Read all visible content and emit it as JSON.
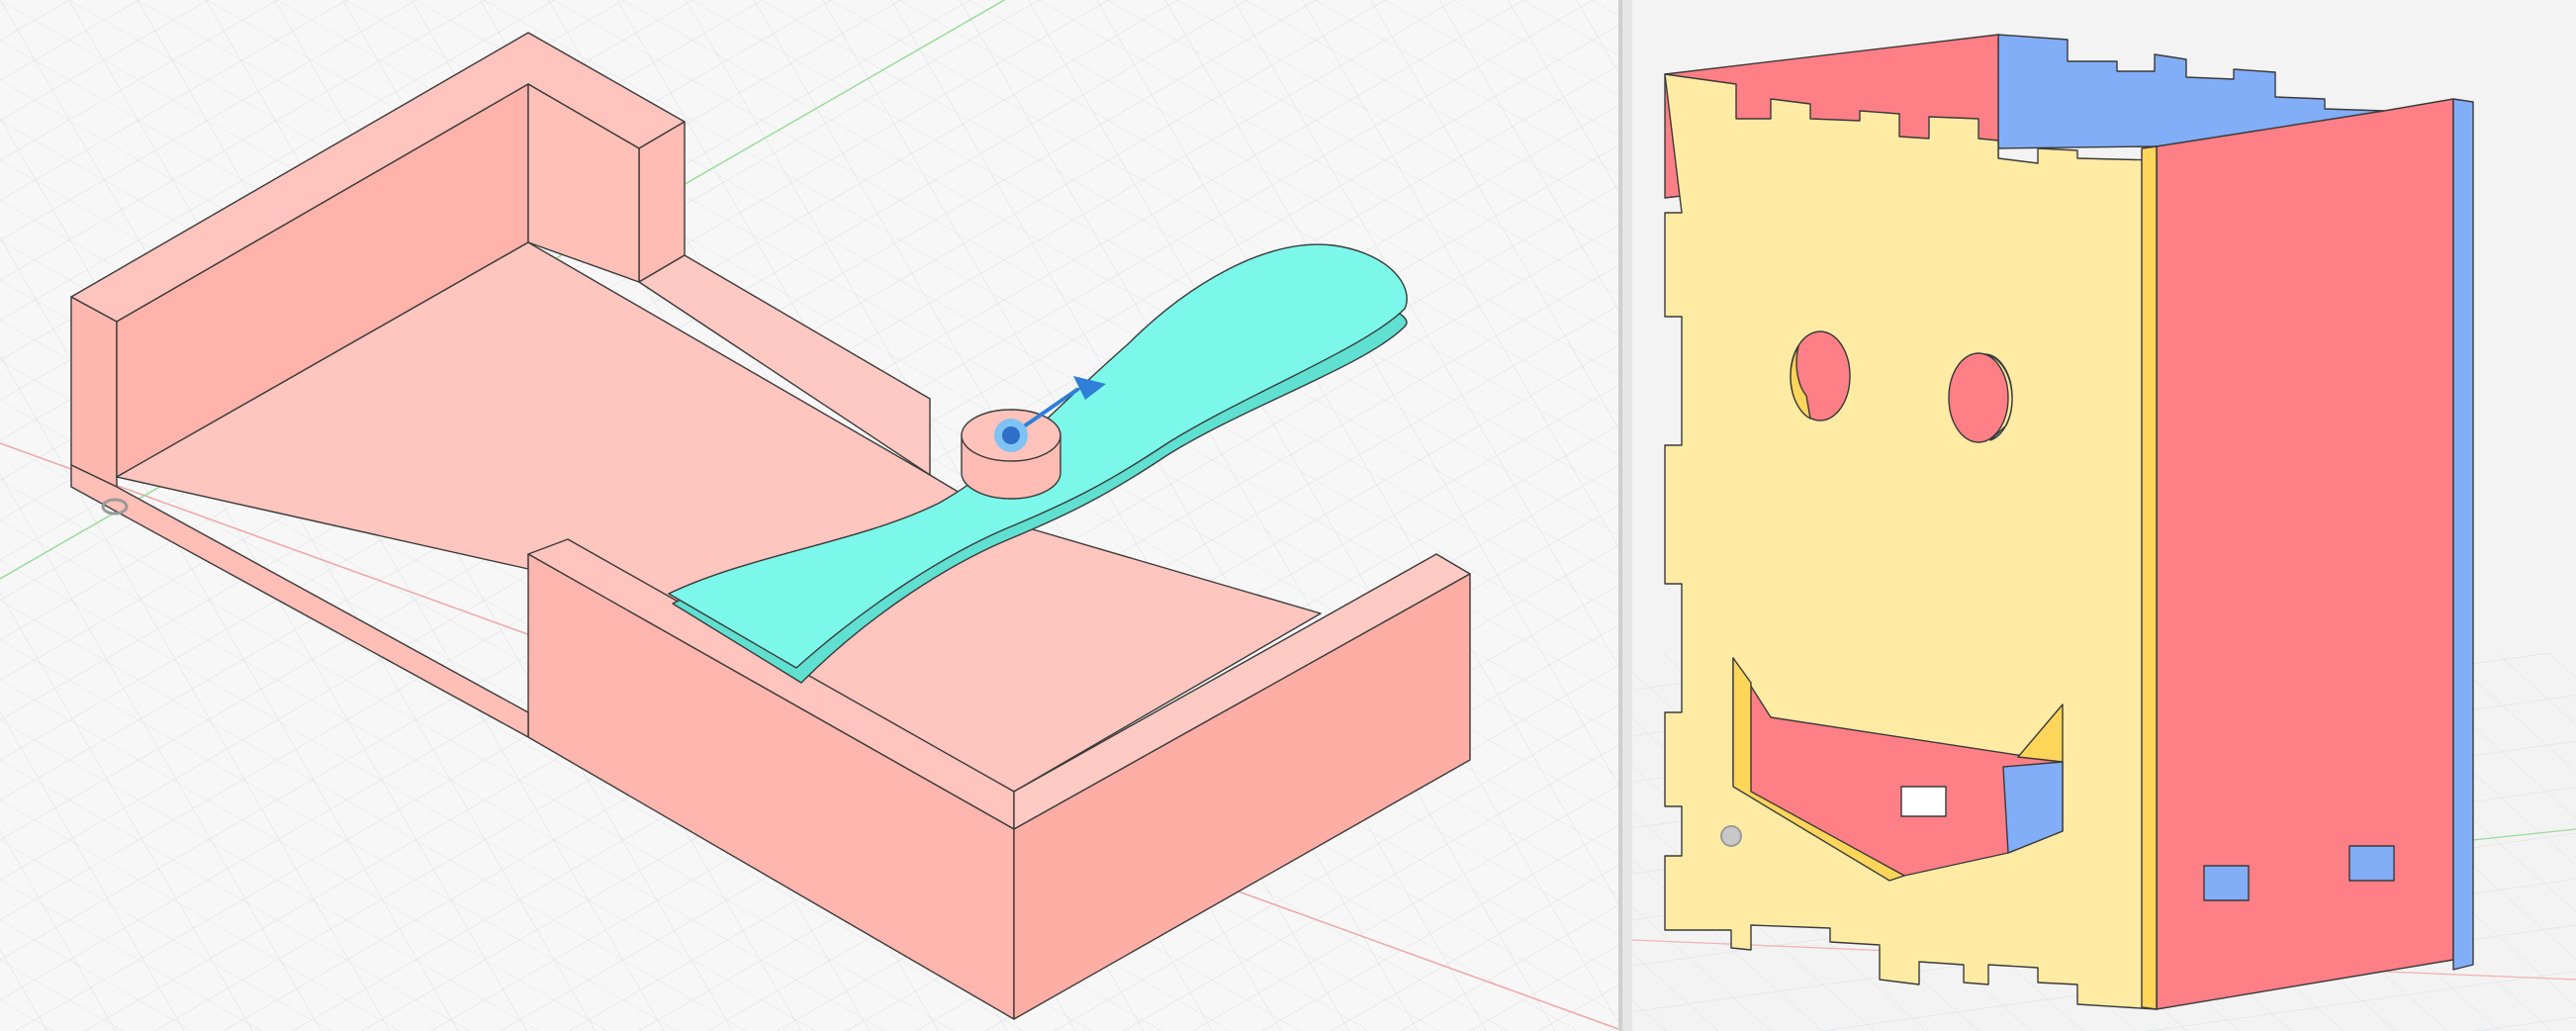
{
  "viewports": [
    {
      "id": "left",
      "description_free": true,
      "model_body_color": "#ffc1ba",
      "model_body_shade_color": "#ffb4ad",
      "propeller_color": "#7af7e8",
      "propeller_shade_color": "#5fe3d5",
      "gizmo_color": "#2f7fd8",
      "grid_color": "#d7dbe0",
      "x_axis_color": "#f2a0a0",
      "y_axis_color": "#8cd98c"
    },
    {
      "id": "right",
      "box_front_color": "#ffeba4",
      "box_side_color": "#ff7f86",
      "box_back_color": "#82adf7",
      "grid_color": "#dde0e4",
      "background_color": "#f2f2f2"
    }
  ],
  "divider_color": "#cfcfcf"
}
